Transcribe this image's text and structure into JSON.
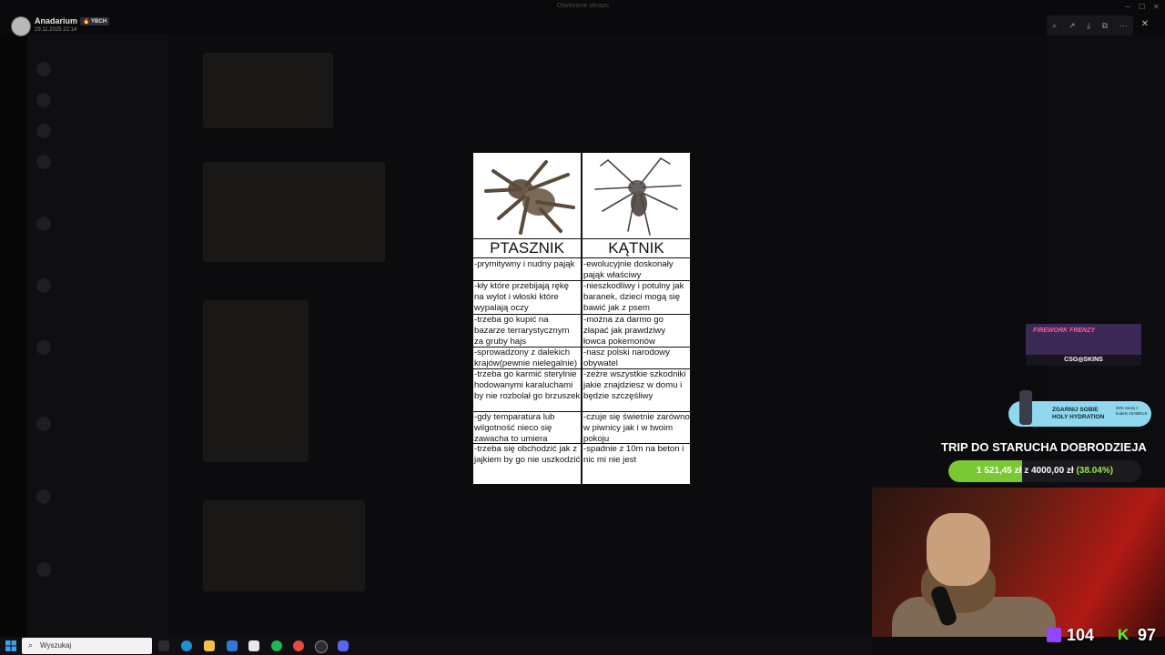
{
  "window": {
    "title": "Otwieranie obrazu"
  },
  "post": {
    "username": "Anadarium",
    "badge": "🔥 YBCH",
    "date": "29.11.2025 22:14"
  },
  "toolbar": {
    "icons": [
      "zoom-icon",
      "share-icon",
      "download-icon",
      "open-icon",
      "more-icon"
    ]
  },
  "meme": {
    "left_header": "PTASZNIK",
    "right_header": "KĄTNIK",
    "rows": [
      {
        "left": "-prymitywny i nudny pająk",
        "right": "-ewolucyjnie doskonały pająk właściwy"
      },
      {
        "left": "-kły które przebijają rękę na wylot i włoski które wypalają oczy",
        "right": "-nieszkodliwy i potulny jak baranek, dzieci mogą się bawić jak z psem"
      },
      {
        "left": "-trzeba go kupić na bazarze terrarystycznym za gruby hajs",
        "right": "-można za darmo go złapać jak prawdziwy łowca pokemonów"
      },
      {
        "left": "-sprowadzony z dalekich krajów(pewnie nielegalnie)",
        "right": "-nasz polski narodowy obywatel"
      },
      {
        "left": "-trzeba go karmić sterylnie hodowanymi karaluchami by nie rozbolał go brzuszek",
        "right": "-zeżre wszystkie szkodniki jakie znajdziesz w domu i będzie szczęśliwy"
      },
      {
        "left": "-gdy temparatura lub wilgotność nieco się zawacha to umiera",
        "right": "-czuje się świetnie zarówno w piwnicy jak i w twoim pokoju"
      },
      {
        "left": "-trzeba się obchodzić jak z jajkiem by go nie uszkodzić",
        "right": "-spadnie z 10m na beton i nic mi nie jest"
      }
    ]
  },
  "overlay": {
    "ad1_title": "FIREWORK FRENZY",
    "ad1_brand": "CSG◎SKINS",
    "ad2_text": "ZGARNIJ SOBIE HOLY HYDRATION",
    "ad2_small": "50% taniej z kodem DIABEUS",
    "goal_title": "TRIP DO STARUCHA DOBRODZIEJA",
    "goal_text": "1 521,45 zł z 4000,00 zł",
    "goal_percent_text": "(38.04%)",
    "goal_fraction": 0.3804,
    "twitch_viewers": "104",
    "kick_viewers": "97"
  },
  "taskbar": {
    "search_placeholder": "Wyszukaj",
    "apps": [
      "task-view-icon",
      "edge-icon",
      "file-explorer-icon",
      "mail-icon",
      "store-icon",
      "spotify-icon",
      "chrome-icon",
      "obs-icon",
      "discord-icon"
    ]
  },
  "colors": {
    "goal_fill": "#7bc932",
    "twitch": "#9146ff",
    "kick": "#53fc18"
  }
}
